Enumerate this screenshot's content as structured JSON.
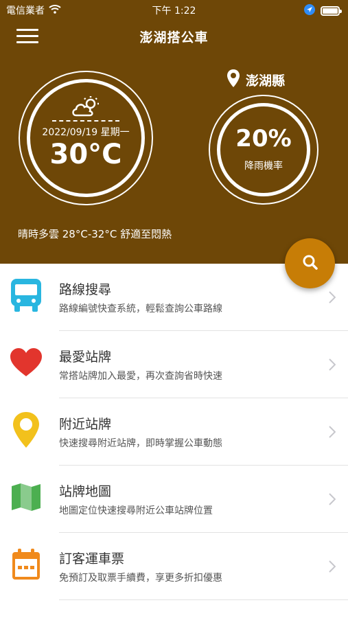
{
  "status_bar": {
    "carrier": "電信業者",
    "time": "下午 1:22"
  },
  "header": {
    "title": "澎湖搭公車",
    "background_color": "#6e4707"
  },
  "weather": {
    "date": "2022/09/19 星期一",
    "temperature": "30°C",
    "icon": "partly-cloudy-icon",
    "location": "澎湖縣",
    "rain_percent": "20%",
    "rain_label": "降雨機率",
    "description": "晴時多雲 28°C-32°C 舒適至悶熱"
  },
  "fab": {
    "icon": "search-icon",
    "color": "#c77d06"
  },
  "menu": {
    "items": [
      {
        "title": "路線搜尋",
        "subtitle": "路線編號快查系統，輕鬆查詢公車路線",
        "icon": "bus-icon",
        "color": "#29b6e0"
      },
      {
        "title": "最愛站牌",
        "subtitle": "常搭站牌加入最愛，再次查詢省時快速",
        "icon": "heart-icon",
        "color": "#e2352d"
      },
      {
        "title": "附近站牌",
        "subtitle": "快速搜尋附近站牌，即時掌握公車動態",
        "icon": "location-pin-icon",
        "color": "#f2c11c"
      },
      {
        "title": "站牌地圖",
        "subtitle": "地圖定位快速搜尋附近公車站牌位置",
        "icon": "map-icon",
        "color": "#4caf50"
      },
      {
        "title": "訂客運車票",
        "subtitle": "免預訂及取票手續費，享更多折扣優惠",
        "icon": "calendar-icon",
        "color": "#f08a1c"
      }
    ]
  }
}
